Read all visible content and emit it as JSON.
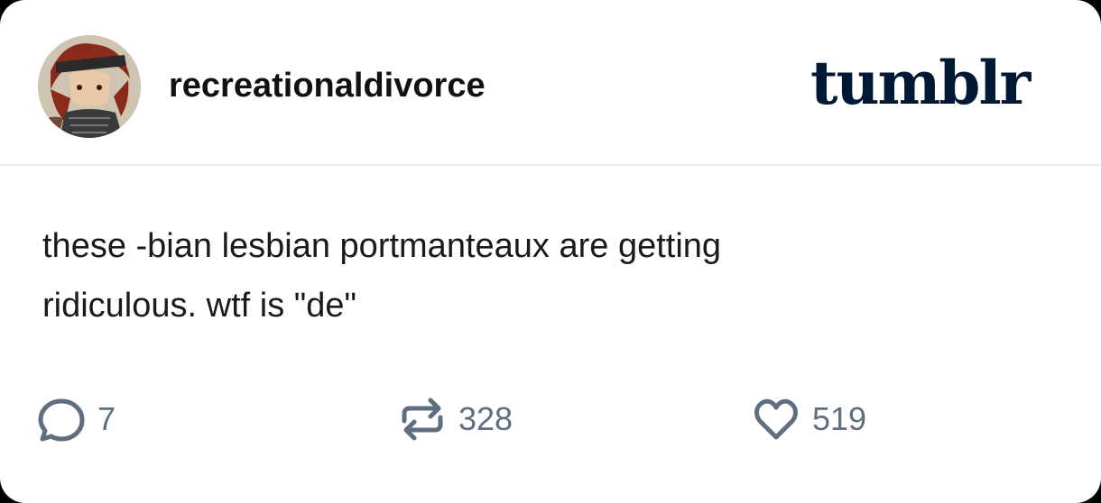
{
  "post": {
    "username": "recreationaldivorce",
    "logo": "tumblr",
    "body_line1": "these -bian lesbian portmanteaux are getting",
    "body_line2": "ridiculous. wtf is \"de\"",
    "avatar_icon": "profile-avatar-icon"
  },
  "actions": {
    "reply_icon": "comment-bubble-icon",
    "reply_count": "7",
    "reblog_icon": "reblog-icon",
    "reblog_count": "328",
    "like_icon": "heart-icon",
    "like_count": "519"
  },
  "colors": {
    "logo": "#001935",
    "icon": "#5f6f7f",
    "text": "#1a1a1a",
    "divider": "#ececec"
  }
}
